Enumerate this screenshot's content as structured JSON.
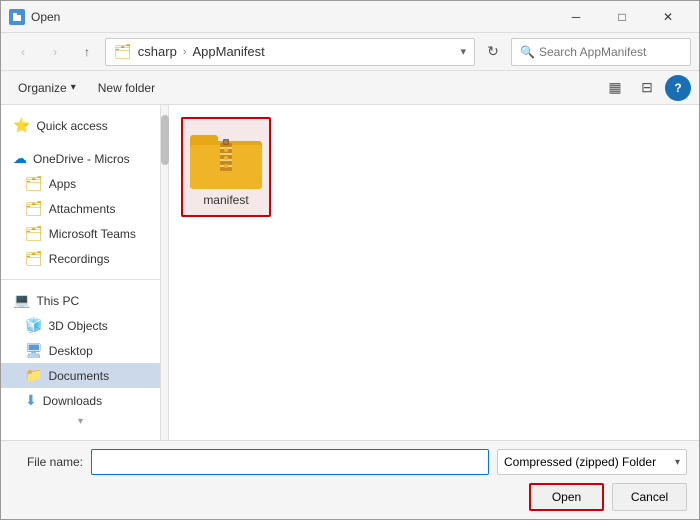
{
  "dialog": {
    "title": "Open",
    "title_icon": "📂"
  },
  "titlebar": {
    "title": "Open",
    "minimize": "─",
    "maximize": "□",
    "close": "✕"
  },
  "addressbar": {
    "back_tooltip": "Back",
    "forward_tooltip": "Forward",
    "up_tooltip": "Up",
    "path_parts": [
      "csharp",
      "AppManifest"
    ],
    "refresh_tooltip": "Refresh",
    "search_placeholder": "Search AppManifest",
    "chevron_down": "▾"
  },
  "toolbar": {
    "organize_label": "Organize",
    "new_folder_label": "New folder",
    "view_icon": "▦",
    "pane_icon": "⊟",
    "help_label": "?"
  },
  "sidebar": {
    "quick_access_label": "Quick access",
    "quick_access_icon": "⭐",
    "onedrive_label": "OneDrive - Micros",
    "onedrive_icon": "☁",
    "items": [
      {
        "label": "Apps",
        "icon": "🗂",
        "selected": false
      },
      {
        "label": "Attachments",
        "icon": "🗂",
        "selected": false
      },
      {
        "label": "Microsoft Teams",
        "icon": "🗂",
        "selected": false
      },
      {
        "label": "Recordings",
        "icon": "🗂",
        "selected": false
      }
    ],
    "this_pc_label": "This PC",
    "this_pc_icon": "💻",
    "pc_items": [
      {
        "label": "3D Objects",
        "icon": "🧊",
        "selected": false
      },
      {
        "label": "Desktop",
        "icon": "🖥",
        "selected": false
      },
      {
        "label": "Documents",
        "icon": "📁",
        "selected": true
      },
      {
        "label": "Downloads",
        "icon": "⬇",
        "selected": false
      }
    ]
  },
  "files": [
    {
      "name": "manifest",
      "type": "zip"
    }
  ],
  "bottom": {
    "filename_label": "File name:",
    "filename_value": "",
    "filename_placeholder": "",
    "filetype_label": "Compressed (zipped) Folder",
    "open_label": "Open",
    "cancel_label": "Cancel"
  },
  "colors": {
    "accent": "#0078d7",
    "selected_border": "#cc0000",
    "folder_yellow": "#e6a817",
    "zip_stripe": "#c8891a"
  }
}
